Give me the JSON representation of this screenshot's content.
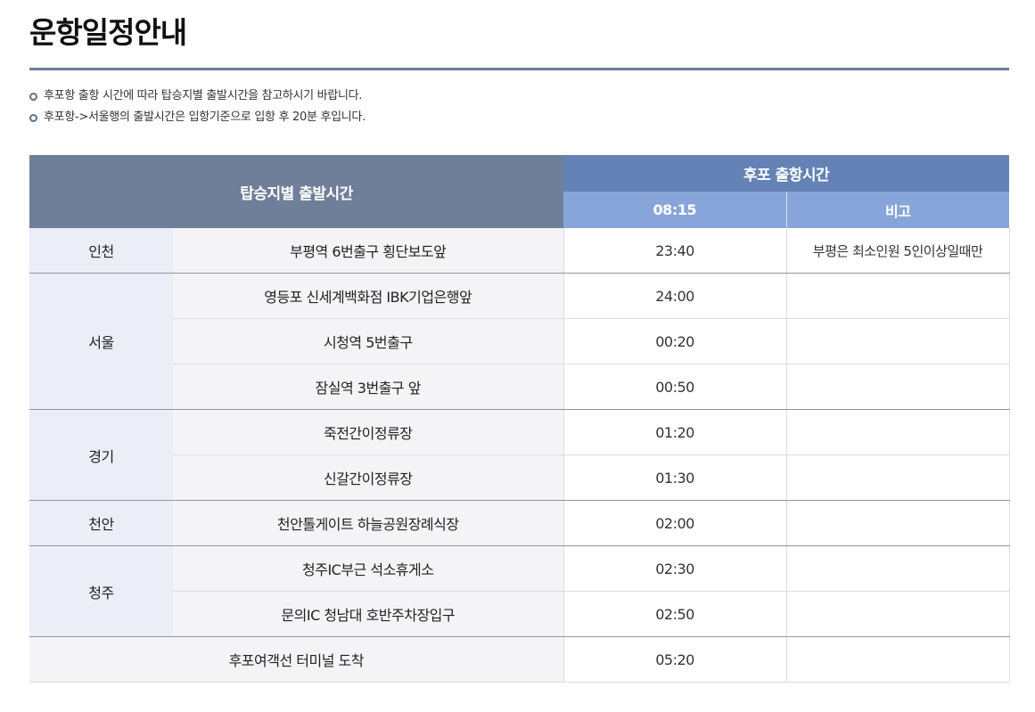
{
  "page_title": "운항일정안내",
  "notes": [
    "후포항 출항 시간에 따라 탑승지별 출발시간을 참고하시기 바랍니다.",
    "후포항->서울행의 출발시간은 입항기준으로 입항 후 20분 후입니다."
  ],
  "table": {
    "header_boarding": "탑승지별 출발시간",
    "header_departure": "후포 출항시간",
    "header_time": "08:15",
    "header_note": "비고",
    "regions": [
      "인천",
      "서울",
      "경기",
      "천안",
      "청주"
    ],
    "rows": [
      {
        "stop": "부평역 6번출구 횡단보도앞",
        "time": "23:40",
        "note": "부평은 최소인원 5인이상일때만"
      },
      {
        "stop": "영등포 신세계백화점 IBK기업은행앞",
        "time": "24:00",
        "note": ""
      },
      {
        "stop": "시청역 5번출구",
        "time": "00:20",
        "note": ""
      },
      {
        "stop": "잠실역 3번출구 앞",
        "time": "00:50",
        "note": ""
      },
      {
        "stop": "죽전간이정류장",
        "time": "01:20",
        "note": ""
      },
      {
        "stop": "신갈간이정류장",
        "time": "01:30",
        "note": ""
      },
      {
        "stop": "천안톨게이트 하늘공원장례식장",
        "time": "02:00",
        "note": ""
      },
      {
        "stop": "청주IC부근 석소휴게소",
        "time": "02:30",
        "note": ""
      },
      {
        "stop": "문의IC 청남대 호반주차장입구",
        "time": "02:50",
        "note": ""
      }
    ],
    "arrival": {
      "label": "후포여객선 터미널 도착",
      "time": "05:20",
      "note": ""
    }
  }
}
